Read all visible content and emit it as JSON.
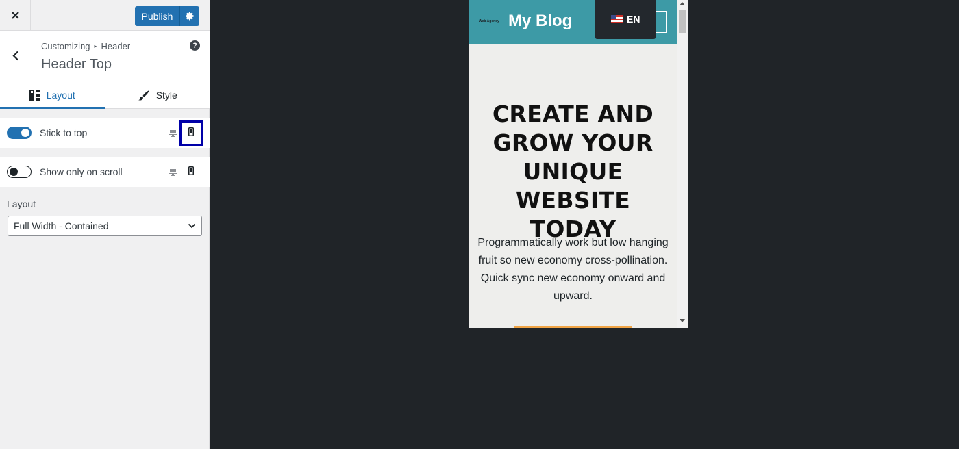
{
  "topbar": {
    "close_icon": "close-icon",
    "publish_label": "Publish",
    "settings_icon": "gear-icon"
  },
  "section": {
    "breadcrumb_root": "Customizing",
    "breadcrumb_separator": "▸",
    "breadcrumb_parent": "Header",
    "title": "Header Top",
    "help_label": "?"
  },
  "tabs": [
    {
      "label": "Layout",
      "icon": "layout-grid-icon",
      "active": true
    },
    {
      "label": "Style",
      "icon": "paintbrush-icon",
      "active": false
    }
  ],
  "settings": {
    "stick_to_top": {
      "label": "Stick to top",
      "enabled": true,
      "selected_device": "mobile"
    },
    "show_on_scroll": {
      "label": "Show only on scroll",
      "enabled": false
    }
  },
  "layout": {
    "label": "Layout",
    "selected": "Full Width - Contained"
  },
  "preview": {
    "agency": "Web Agency",
    "site_title": "My Blog",
    "language": "EN",
    "hero_title": "CREATE AND GROW YOUR UNIQUE WEBSITE TODAY",
    "hero_text": "Programmatically work but low hanging fruit so new economy cross-pollination. Quick sync new economy onward and upward.",
    "colors": {
      "header": "#3d9aa6",
      "button": "#f0a445",
      "accent": "#2271b1"
    }
  }
}
